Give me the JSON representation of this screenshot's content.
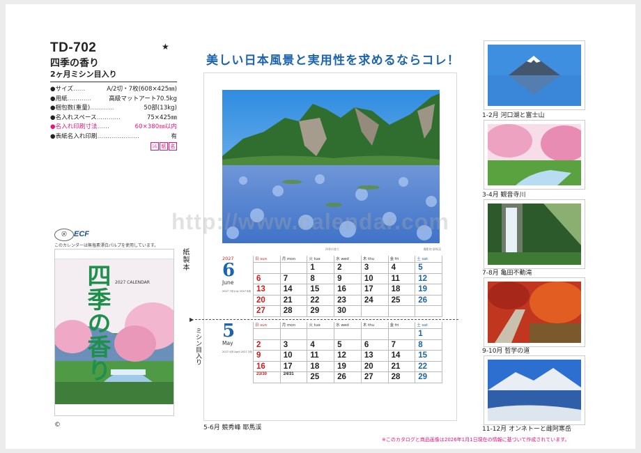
{
  "product": {
    "code": "TD-702",
    "star": "★",
    "title": "四季の香り",
    "subtitle": "2ヶ月ミシン目入り"
  },
  "specs": [
    {
      "key": "●サイズ",
      "dots": "……",
      "value": "A/2切・7枚(608×425㎜)",
      "highlight": false
    },
    {
      "key": "●用紙",
      "dots": "…………",
      "value": "高級マットアート70.5kg",
      "highlight": false
    },
    {
      "key": "●梱包数(重量)",
      "dots": "…………",
      "value": "50部(13kg)",
      "highlight": false
    },
    {
      "key": "●名入れスペース",
      "dots": "…………",
      "value": "75×425㎜",
      "highlight": false
    },
    {
      "key": "●名入れ印刷寸法",
      "dots": "……",
      "value": "60×380㎜以内",
      "highlight": true
    },
    {
      "key": "●表紙名入れ印刷",
      "dots": "…………………",
      "value": "有",
      "highlight": false
    }
  ],
  "marks": [
    "ｼﾙ",
    "紙",
    "名"
  ],
  "ecf": {
    "logo": "ECF",
    "note": "このカレンダーは無塩素漂白パルプを使用しています。"
  },
  "thumbnail": {
    "vertical_title": "四季の香り",
    "calendar_label": "2027 CALENDAR",
    "paper_label": "紙製本"
  },
  "copyright": "©",
  "headline": "美しい日本風景と実用性を求めるならコレ！",
  "calendar": {
    "center_label": "四季の香り",
    "credit": "撮影地 耶馬渓",
    "weekdays": [
      {
        "label": "日 sun",
        "type": "sun"
      },
      {
        "label": "月 mon",
        "type": ""
      },
      {
        "label": "火 tue",
        "type": ""
      },
      {
        "label": "水 wed",
        "type": ""
      },
      {
        "label": "木 thu",
        "type": ""
      },
      {
        "label": "金 fri",
        "type": ""
      },
      {
        "label": "土 sat",
        "type": "sat"
      }
    ],
    "months": [
      {
        "year": "2027",
        "number": "6",
        "english": "June",
        "mini": "2027 7月 July  2027 8月",
        "days": [
          "",
          "",
          "1",
          "2",
          "3",
          "4",
          "5",
          "6",
          "7",
          "8",
          "9",
          "10",
          "11",
          "12",
          "13",
          "14",
          "15",
          "16",
          "17",
          "18",
          "19",
          "20",
          "21",
          "22",
          "23",
          "24",
          "25",
          "26",
          "27",
          "28",
          "29",
          "30",
          "",
          "",
          ""
        ]
      },
      {
        "year": "",
        "number": "5",
        "english": "May",
        "mini": "2027 4月 April  2027 3月",
        "days": [
          "",
          "",
          "",
          "",
          "",
          "",
          "1",
          "2",
          "3",
          "4",
          "5",
          "6",
          "7",
          "8",
          "9",
          "10",
          "11",
          "12",
          "13",
          "14",
          "15",
          "16",
          "17",
          "18",
          "19",
          "20",
          "21",
          "22",
          "23/30",
          "24/31",
          "25",
          "26",
          "27",
          "28",
          "29"
        ]
      }
    ],
    "perforation_label": "ミシン目入り",
    "caption": "5-6月 競秀峰 耶馬渓"
  },
  "right_thumbs": [
    {
      "caption": "1-2月 河口湖と富士山"
    },
    {
      "caption": "3-4月 観音寺川"
    },
    {
      "caption": "7-8月 亀田不動滝"
    },
    {
      "caption": "9-10月 哲学の道"
    },
    {
      "caption": "11-12月 オンネトーと雌阿寒岳"
    }
  ],
  "footnote": "※このカタログと商品画像は2026年1月1日現在の情報に基づいて作成されています。",
  "watermark": "http://www.calendar.com",
  "colors": {
    "accent": "#1c64ad",
    "pink": "#e2177e",
    "sunday": "#c7201f"
  }
}
